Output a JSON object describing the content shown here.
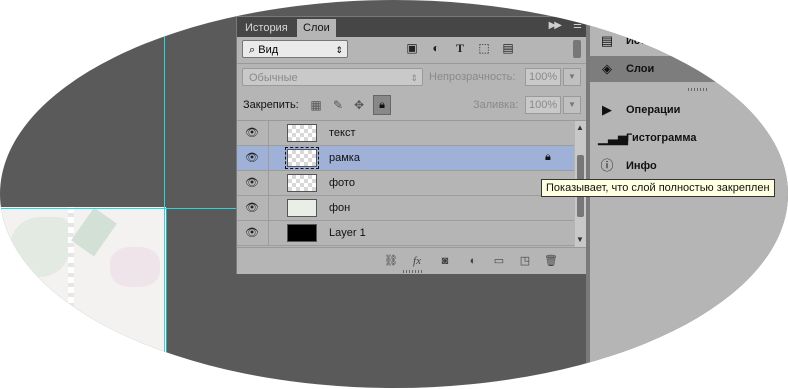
{
  "tabs": [
    {
      "label": "История",
      "active": false
    },
    {
      "label": "Слои",
      "active": true
    }
  ],
  "panel_menu_icons": {
    "collapse": "double-arrow-icon",
    "menu": "panel-menu-icon"
  },
  "filter": {
    "kind_label": "Вид",
    "icons": [
      "image-filter-icon",
      "adjustment-filter-icon",
      "type-filter-icon",
      "shape-filter-icon",
      "smart-object-filter-icon"
    ]
  },
  "blend": {
    "mode": "Обычные",
    "opacity_label": "Непрозрачность:",
    "opacity_value": "100%",
    "fill_label": "Заливка:",
    "fill_value": "100%"
  },
  "lock": {
    "label": "Закрепить:",
    "icons": [
      "lock-transparent-icon",
      "lock-image-icon",
      "lock-position-icon",
      "lock-all-icon"
    ]
  },
  "layers": [
    {
      "name": "текст",
      "thumb": "transparent",
      "selected": false,
      "locked": false
    },
    {
      "name": "рамка",
      "thumb": "transparent",
      "selected": true,
      "locked": true
    },
    {
      "name": "фото",
      "thumb": "transparent",
      "selected": false,
      "locked": false
    },
    {
      "name": "фон",
      "thumb": "light",
      "selected": false,
      "locked": false
    },
    {
      "name": "Layer 1",
      "thumb": "black",
      "selected": false,
      "locked": false
    }
  ],
  "bottom_icons": [
    "link-icon",
    "fx-icon",
    "mask-icon",
    "adjustment-layer-icon",
    "folder-icon",
    "new-layer-icon",
    "trash-icon"
  ],
  "dock": {
    "items": [
      {
        "label": "История",
        "icon": "history-icon",
        "selected": false
      },
      {
        "label": "Слои",
        "icon": "layers-icon",
        "selected": true
      },
      {
        "label": "Операции",
        "icon": "play-icon",
        "selected": false
      },
      {
        "label": "Гистограмма",
        "icon": "histogram-icon",
        "selected": false
      },
      {
        "label": "Инфо",
        "icon": "info-icon",
        "selected": false
      }
    ]
  },
  "tooltip": "Показывает, что слой полностью закреплен",
  "colors": {
    "selected_row": "#9fb1d6",
    "guide": "#29d6de",
    "workspace": "#5a5a5a",
    "panel": "#b5b5b5"
  }
}
